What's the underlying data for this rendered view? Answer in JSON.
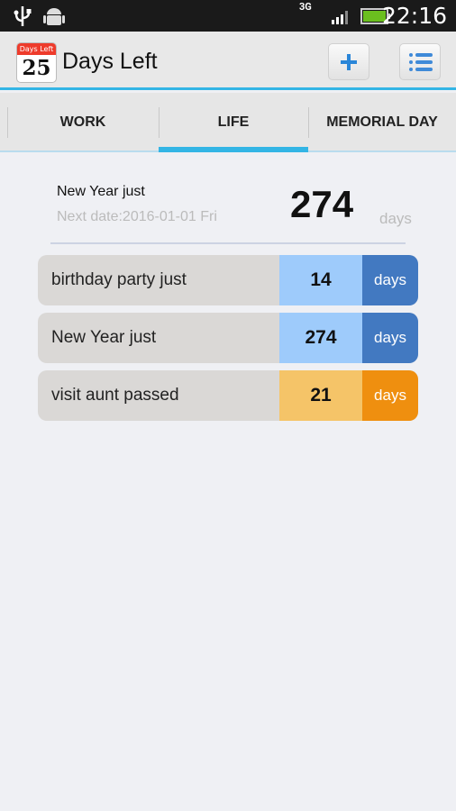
{
  "status_bar": {
    "time": "22:16",
    "network": "3G",
    "icons": [
      "usb-icon",
      "android-debug-icon",
      "3g-icon",
      "signal-icon",
      "battery-icon"
    ]
  },
  "app": {
    "title": "Days Left",
    "logo_top": "Days Left",
    "logo_number": "25"
  },
  "tabs": [
    {
      "label": "WORK",
      "selected": false
    },
    {
      "label": "LIFE",
      "selected": true
    },
    {
      "label": "MEMORIAL DAY",
      "selected": false
    }
  ],
  "summary": {
    "name": "New Year just",
    "next_date": "Next date:2016-01-01 Fri",
    "count": "274",
    "unit": "days"
  },
  "events": [
    {
      "name": "birthday party just",
      "count": "14",
      "unit": "days",
      "count_color": "#9ecbfb",
      "unit_color": "#4279c1"
    },
    {
      "name": "New Year just",
      "count": "274",
      "unit": "days",
      "count_color": "#9ecbfb",
      "unit_color": "#4279c1"
    },
    {
      "name": "visit aunt passed",
      "count": "21",
      "unit": "days",
      "count_color": "#f5c468",
      "unit_color": "#ef8f0f"
    }
  ],
  "colors": {
    "accent": "#33b5e5"
  }
}
